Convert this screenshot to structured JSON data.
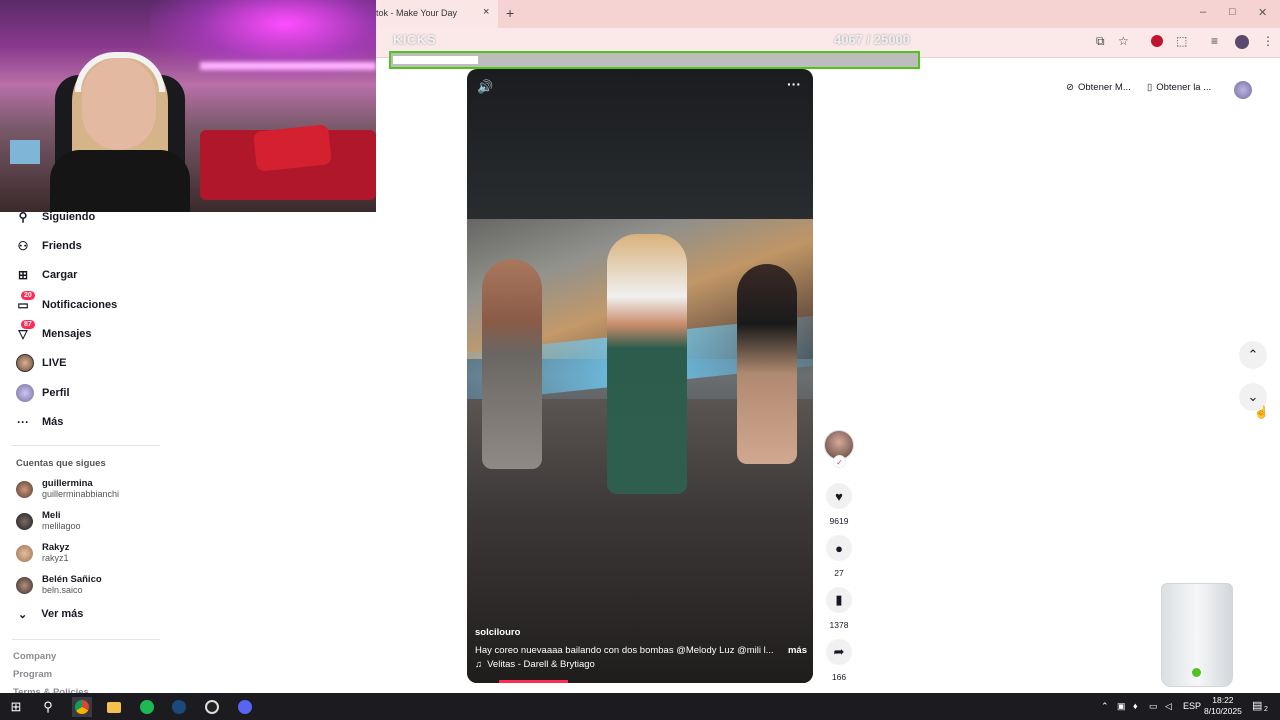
{
  "browser": {
    "tab_title": "tok - Make Your Day",
    "tab_close": "×",
    "new_tab": "+",
    "window_controls": [
      "–",
      "□",
      "✕"
    ]
  },
  "overlay": {
    "kicks_label": "KICKS",
    "kicks_count": "4067 / 25000",
    "kicks_progress": 0.163
  },
  "sidebar": {
    "items": [
      {
        "label": "Siguiendo",
        "icon": "following-icon"
      },
      {
        "label": "Friends",
        "icon": "friends-icon"
      },
      {
        "label": "Cargar",
        "icon": "upload-icon"
      },
      {
        "label": "Notificaciones",
        "icon": "notifications-icon",
        "badge": "20"
      },
      {
        "label": "Mensajes",
        "icon": "messages-icon",
        "badge": "87"
      },
      {
        "label": "LIVE",
        "icon": "live-icon"
      },
      {
        "label": "Perfil",
        "icon": "profile-icon"
      },
      {
        "label": "Más",
        "icon": "more-icon"
      }
    ],
    "following_title": "Cuentas que sigues",
    "accounts": [
      {
        "name": "guillermina",
        "handle": "guillerminabbianchi"
      },
      {
        "name": "Meli",
        "handle": "melilagoo"
      },
      {
        "name": "Rakyz",
        "handle": "rakyz1"
      },
      {
        "name": "Belén Sañico",
        "handle": "beln.saico"
      }
    ],
    "see_more": "Ver más",
    "footer": [
      "Company",
      "Program",
      "Terms & Policies"
    ]
  },
  "video": {
    "author": "solcilouro",
    "caption": "Hay coreo nuevaaaa bailando con dos bombas @Melody Luz  @mili l...",
    "caption_more": "más",
    "music": "Velitas - Darell & Brytiago",
    "progress": 0.2
  },
  "actions": {
    "likes": "9619",
    "comments": "27",
    "saves": "1378",
    "shares": "166"
  },
  "top_right": {
    "get_app_1": "Obtener M...",
    "get_app_2": "Obtener la ..."
  },
  "taskbar": {
    "lang": "ESP",
    "time": "18:22",
    "date": "8/10/2025",
    "notif_count": "2"
  },
  "colors": {
    "accent": "#fe2c55",
    "kicks_green": "#53c21f",
    "tabstrip": "#f6d3d3"
  }
}
